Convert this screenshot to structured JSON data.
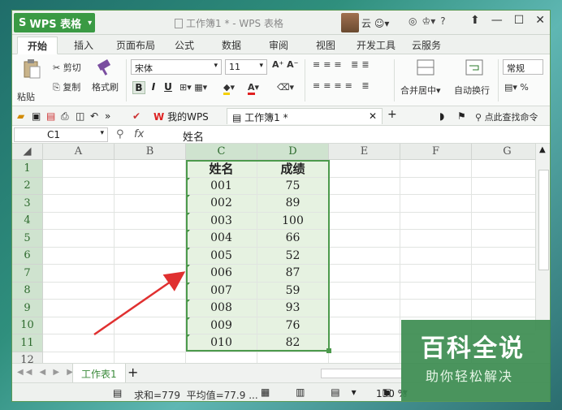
{
  "app": {
    "name": "WPS 表格",
    "logo": "S",
    "window_title": "工作簿1 * - WPS 表格",
    "user_name": "云",
    "help": "?"
  },
  "ribbon_tabs": [
    "开始",
    "插入",
    "页面布局",
    "公式",
    "数据",
    "审阅",
    "视图",
    "开发工具",
    "云服务"
  ],
  "ribbon": {
    "paste": "粘贴",
    "cut": "剪切",
    "copy": "复制",
    "format_painter": "格式刷",
    "font_name": "宋体",
    "font_size": "11",
    "bold": "B",
    "italic": "I",
    "underline": "U",
    "merge_center": "合并居中",
    "wrap_text": "自动换行",
    "number_style": "常规",
    "percent": "%"
  },
  "doc_tabs": {
    "my_wps": "我的WPS",
    "current": "工作簿1 *",
    "search": "点此查找命令"
  },
  "formula_bar": {
    "cell_ref": "C1",
    "fx": "fx",
    "content": "姓名"
  },
  "grid": {
    "columns": [
      "A",
      "B",
      "C",
      "D",
      "E",
      "F",
      "G"
    ],
    "rows": [
      "1",
      "2",
      "3",
      "4",
      "5",
      "6",
      "7",
      "8",
      "9",
      "10",
      "11",
      "12"
    ],
    "headers": [
      "姓名",
      "成绩"
    ],
    "records": [
      [
        "001",
        "75"
      ],
      [
        "002",
        "89"
      ],
      [
        "003",
        "100"
      ],
      [
        "004",
        "66"
      ],
      [
        "005",
        "52"
      ],
      [
        "006",
        "87"
      ],
      [
        "007",
        "59"
      ],
      [
        "008",
        "93"
      ],
      [
        "009",
        "76"
      ],
      [
        "010",
        "82"
      ]
    ]
  },
  "sheets": {
    "active": "工作表1",
    "add": "+"
  },
  "status": {
    "sum": "求和=779",
    "avg": "平均值=77.9 ...",
    "zoom": "130 %"
  },
  "watermark": {
    "line1": "百科全说",
    "line2": "助你轻松解决"
  },
  "colors": {
    "accent": "#3a9a44",
    "selection": "#4c9a4c",
    "arrow": "#e03030"
  }
}
